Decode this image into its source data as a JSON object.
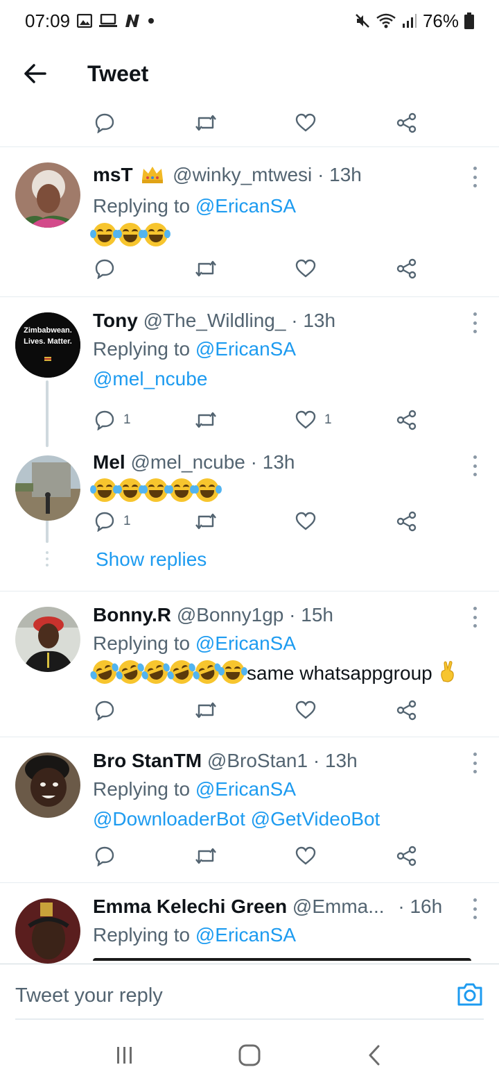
{
  "status_bar": {
    "time": "07:09",
    "battery": "76%",
    "icons_left": [
      "image-icon",
      "screen-cast-icon",
      "n-logo-icon",
      "dot-icon"
    ],
    "icons_right": [
      "mute-icon",
      "wifi-icon",
      "signal-icon",
      "battery-icon"
    ]
  },
  "header": {
    "title": "Tweet"
  },
  "colors": {
    "accent": "#1d9bf0",
    "muted": "#536471",
    "text": "#0f1419",
    "divider": "#e6ecf0"
  },
  "tweets": [
    {
      "name": "msT",
      "badge": "crown-emoji",
      "handle": "@winky_mtwesi",
      "time": "· 13h",
      "replying_prefix": "Replying to",
      "replying_to": "@EricanSA",
      "emoji": [
        "face-with-tears-of-joy",
        "face-with-tears-of-joy",
        "face-with-tears-of-joy"
      ]
    },
    {
      "name": "Tony",
      "handle": "@The_Wildling_",
      "time": "· 13h",
      "replying_prefix": "Replying to",
      "replying_to": "@EricanSA",
      "text": "@mel_ncube",
      "avatar_text": "Zimbabwean. Lives. Matter.",
      "reply_count": "1",
      "like_count": "1"
    },
    {
      "name": "Mel",
      "handle": "@mel_ncube",
      "time": "· 13h",
      "emoji": [
        "face-with-tears-of-joy",
        "face-with-tears-of-joy",
        "face-with-tears-of-joy",
        "face-with-tears-of-joy",
        "face-with-tears-of-joy"
      ],
      "reply_count": "1"
    },
    {
      "name": "Bonny.R",
      "handle": "@Bonny1gp",
      "time": "· 15h",
      "replying_prefix": "Replying to",
      "replying_to": "@EricanSA",
      "emoji": [
        "rolling-on-the-floor-laughing",
        "rolling-on-the-floor-laughing",
        "rolling-on-the-floor-laughing",
        "rolling-on-the-floor-laughing",
        "rolling-on-the-floor-laughing",
        "face-with-tears-of-joy"
      ],
      "text": "same whatsappgroup",
      "trailing_emoji": "crossed-fingers"
    },
    {
      "name": "Bro StanTM",
      "handle": "@BroStan1",
      "time": "· 13h",
      "replying_prefix": "Replying to",
      "replying_to": "@EricanSA",
      "text": "@DownloaderBot @GetVideoBot"
    },
    {
      "name": "Emma Kelechi Green",
      "handle": "@Emma...",
      "time": "· 16h",
      "replying_prefix": "Replying to",
      "replying_to": "@EricanSA"
    }
  ],
  "show_replies": "Show replies",
  "reply_bar": {
    "placeholder": "Tweet your reply"
  }
}
